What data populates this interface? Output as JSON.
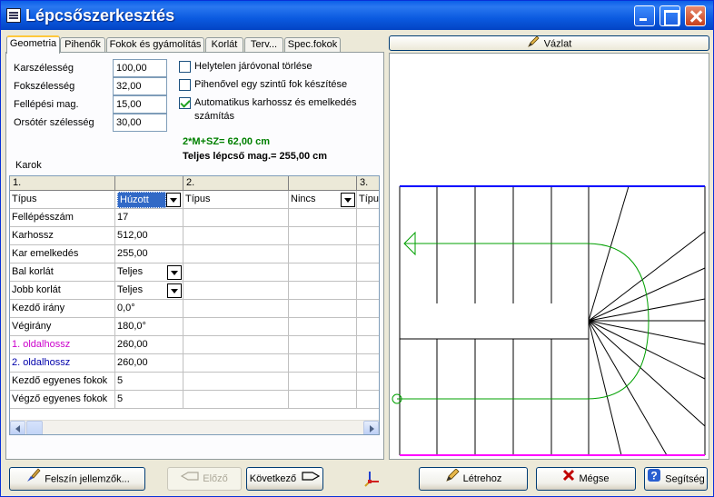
{
  "window": {
    "title": "Lépcsőszerkesztés"
  },
  "tabs": [
    "Geometria",
    "Pihenők",
    "Fokok és gyámolítás",
    "Korlát",
    "Terv...",
    "Spec.fokok"
  ],
  "form": {
    "fields": [
      {
        "label": "Karszélesség",
        "value": "100,00"
      },
      {
        "label": "Fokszélesség",
        "value": "32,00"
      },
      {
        "label": "Fellépési mag.",
        "value": "15,00"
      },
      {
        "label": "Orsótér szélesség",
        "value": "30,00"
      }
    ],
    "checkboxes": [
      {
        "label": "Helytelen járóvonal törlése",
        "checked": false
      },
      {
        "label": "Pihenővel egy szintű fok készítése",
        "checked": false
      },
      {
        "label": "Automatikus karhossz és emelkedés",
        "label2": "számítás",
        "checked": true
      }
    ],
    "formula": "2*M+SZ= 62,00 cm",
    "total_height": "Teljes lépcső mag.= 255,00 cm"
  },
  "karok": {
    "label": "Karok",
    "col_headers": [
      "1.",
      "",
      "2.",
      "",
      "3."
    ],
    "rows": [
      {
        "name": "Típus",
        "val": "Húzott kar",
        "c3": "Típus",
        "c4": "Nincs",
        "c5": "Típu",
        "color": "#000000"
      },
      {
        "name": "Fellépésszám",
        "val": "17",
        "color": "#000000"
      },
      {
        "name": "Karhossz",
        "val": "512,00",
        "color": "#000000"
      },
      {
        "name": "Kar emelkedés",
        "val": "255,00",
        "color": "#000000"
      },
      {
        "name": "Bal korlát",
        "val": "Teljes",
        "color": "#000000"
      },
      {
        "name": "Jobb korlát",
        "val": "Teljes",
        "color": "#000000"
      },
      {
        "name": "Kezdő irány",
        "val": "0,0°",
        "color": "#000000"
      },
      {
        "name": "Végirány",
        "val": "180,0°",
        "color": "#000000"
      },
      {
        "name": "1. oldalhossz",
        "val": "260,00",
        "color": "#cc00cc"
      },
      {
        "name": "2. oldalhossz",
        "val": "260,00",
        "color": "#0000aa"
      },
      {
        "name": "Kezdő egyenes fokok",
        "val": "5",
        "color": "#000000"
      },
      {
        "name": "Végző egyenes fokok",
        "val": "5",
        "color": "#000000"
      }
    ]
  },
  "sketch": {
    "button": "Vázlat",
    "edge_top_color": "#0000ff",
    "edge_bottom_color": "#ff00ff",
    "walkline_color": "#00a000"
  },
  "buttons": {
    "felszin": "Felszín jellemzők...",
    "elozo": "Előző",
    "kovetkezo": "Következő",
    "letrehoz": "Létrehoz",
    "megse": "Mégse",
    "segitseg": "Segítség"
  }
}
